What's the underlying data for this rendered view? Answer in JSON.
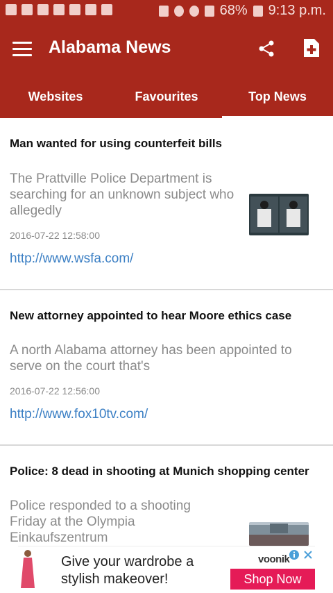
{
  "status_bar": {
    "battery": "68%",
    "time": "9:13 p.m.",
    "signal_label": "R"
  },
  "app_bar": {
    "title": "Alabama News",
    "menu_icon": "hamburger-menu-icon",
    "share_icon": "share-icon",
    "add_icon": "add-file-icon"
  },
  "tabs": [
    {
      "label": "Websites",
      "active": false
    },
    {
      "label": "Favourites",
      "active": false
    },
    {
      "label": "Top News",
      "active": true
    }
  ],
  "news": [
    {
      "title": "Man wanted for using counterfeit bills",
      "description": "The Prattville Police Department is searching for an unknown subject who allegedly",
      "date": "2016-07-22 12:58:00",
      "link": "http://www.wsfa.com/",
      "has_thumbnail": true
    },
    {
      "title": "New attorney appointed to hear Moore ethics case",
      "description": "A north Alabama attorney has been appointed to serve on the court that's",
      "date": "2016-07-22 12:56:00",
      "link": "http://www.fox10tv.com/",
      "has_thumbnail": false
    },
    {
      "title": "Police: 8 dead in shooting at Munich shopping center",
      "description": "Police responded to a shooting Friday at the Olympia Einkaufszentrum",
      "has_thumbnail": true
    }
  ],
  "ad": {
    "text": "Give your wardrobe a stylish makeover!",
    "brand": "voonik",
    "button": "Shop Now",
    "accent": "#e51b57"
  },
  "colors": {
    "primary": "#a8281c",
    "link": "#3b7fc4",
    "muted_text": "#8a8a8a"
  }
}
